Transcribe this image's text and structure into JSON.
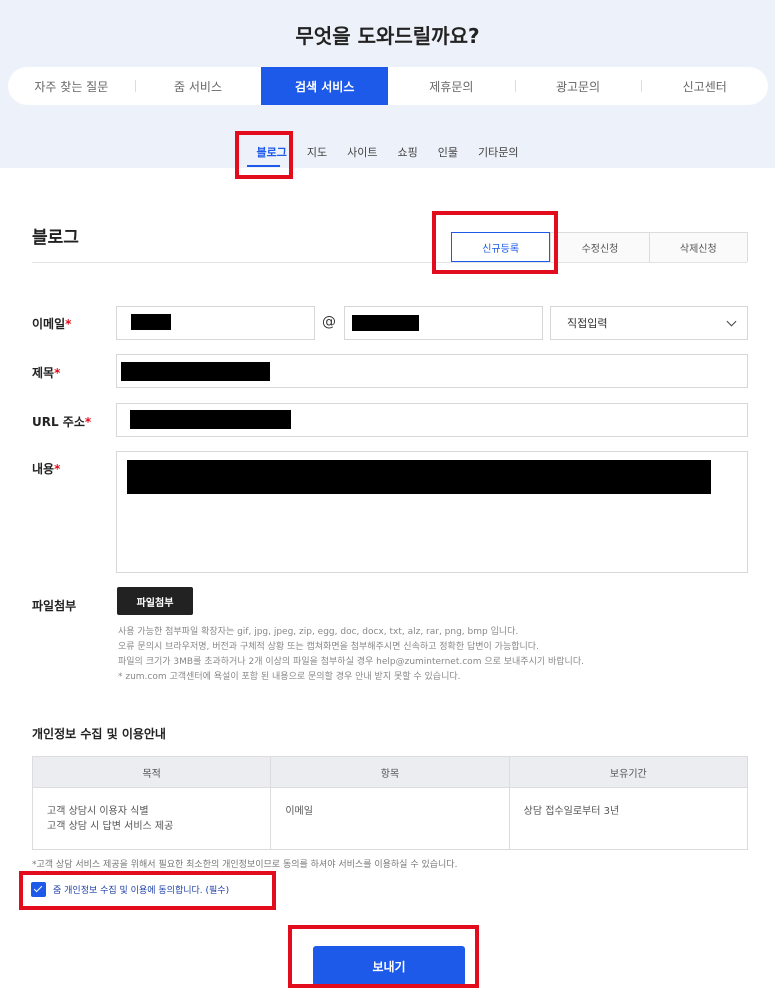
{
  "hero": {
    "title": "무엇을 도와드릴까요?"
  },
  "main_tabs": [
    {
      "label": "자주 찾는 질문"
    },
    {
      "label": "줌 서비스"
    },
    {
      "label": "검색 서비스",
      "active": true
    },
    {
      "label": "제휴문의"
    },
    {
      "label": "광고문의"
    },
    {
      "label": "신고센터"
    }
  ],
  "sub_tabs": [
    {
      "label": "블로그",
      "active": true
    },
    {
      "label": "지도"
    },
    {
      "label": "사이트"
    },
    {
      "label": "쇼핑"
    },
    {
      "label": "인물"
    },
    {
      "label": "기타문의"
    }
  ],
  "section": {
    "title": "블로그"
  },
  "type_tabs": [
    {
      "label": "신규등록",
      "active": true
    },
    {
      "label": "수정신청"
    },
    {
      "label": "삭제신청"
    }
  ],
  "form": {
    "email_label": "이메일",
    "at_sign": "@",
    "domain_select": "직접입력",
    "title_label": "제목",
    "url_label": "URL 주소",
    "content_label": "내용",
    "required_mark": "*",
    "file_label": "파일첨부",
    "file_button": "파일첨부",
    "notes": [
      "사용 가능한 첨부파일 확장자는 gif, jpg, jpeg, zip, egg, doc, docx, txt, alz, rar, png, bmp 입니다.",
      "오류 문의시 브라우저명, 버전과 구체적 상황 또는 캡쳐화면을 첨부해주시면 신속하고 정확한 답변이 가능합니다.",
      "파일의 크기가 3MB를 초과하거나 2개 이상의 파일을 첨부하실 경우 help@zuminternet.com 으로 보내주시기 바랍니다.",
      "* zum.com 고객센터에 욕설이 포함 된 내용으로 문의할 경우 안내 받지 못할 수 있습니다."
    ]
  },
  "privacy": {
    "title": "개인정보 수집 및 이용안내",
    "headers": [
      "목적",
      "항목",
      "보유기간"
    ],
    "purpose_lines": [
      "고객 상담시 이용자 식별",
      "고객 상담 시 답변 서비스 제공"
    ],
    "item": "이메일",
    "period": "상담 접수일로부터 3년",
    "note": "*고객 상담 서비스 제공을 위해서 필요한 최소한의 개인정보이므로 동의를 하셔야 서비스를 이용하실 수 있습니다.",
    "agree_text": "줌 개인정보 수집 및 이용에 동의합니다. (필수)",
    "agreed": true
  },
  "submit": {
    "label": "보내기"
  },
  "colors": {
    "accent": "#1e5ae9",
    "highlight": "#e30c1c",
    "hero_bg": "#edf1f9"
  }
}
